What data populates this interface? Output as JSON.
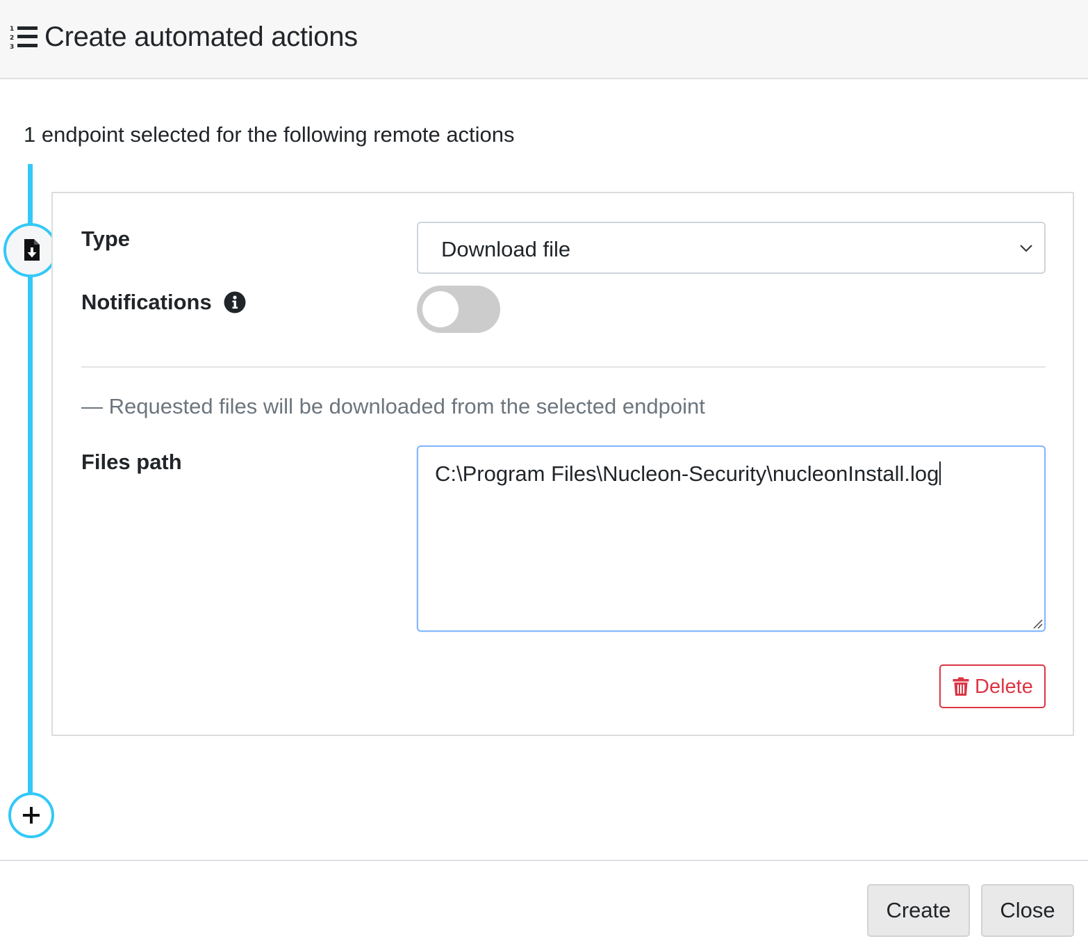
{
  "header": {
    "title": "Create automated actions",
    "icon": "list-ol-icon"
  },
  "subtitle": "1 endpoint selected for the following remote actions",
  "timeline": {
    "color": "#33c8f7",
    "step_icon": "file-download-icon",
    "add_icon": "plus-icon"
  },
  "action": {
    "type_label": "Type",
    "type_value": "Download file",
    "notifications_label": "Notifications",
    "notifications_info_icon": "info-circle-icon",
    "notifications_enabled": false,
    "hint": "— Requested files will be downloaded from the selected endpoint",
    "files_path_label": "Files path",
    "files_path_value": "C:\\Program Files\\Nucleon-Security\\nucleonInstall.log",
    "delete_label": "Delete",
    "delete_color": "#dc3545"
  },
  "footer": {
    "create_label": "Create",
    "close_label": "Close"
  }
}
